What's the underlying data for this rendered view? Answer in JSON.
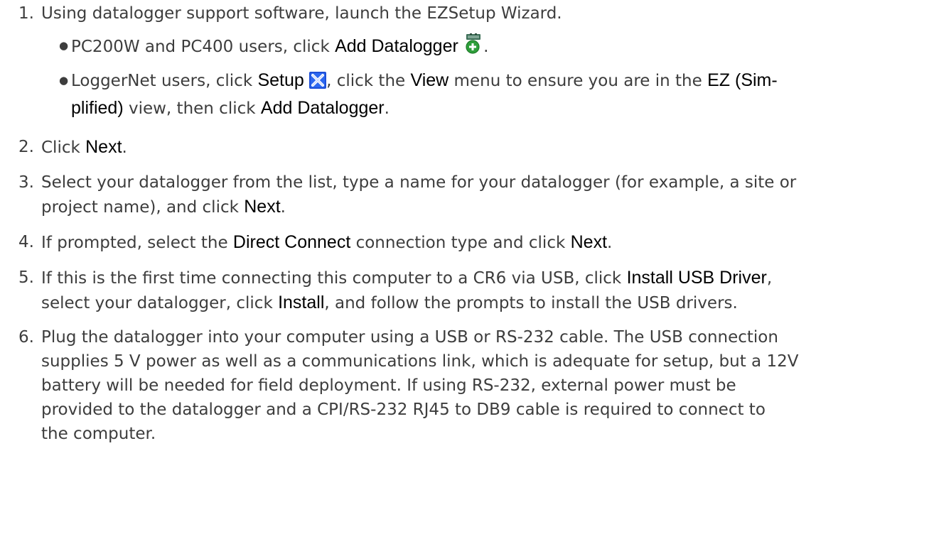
{
  "steps": [
    {
      "number": "1.",
      "text": "Using datalogger support software, launch the EZSetup Wizard.",
      "bullets": [
        {
          "t1": "PC200W and PC400 users, click ",
          "k1": "Add Datalogger",
          "icon": "add-datalogger-icon",
          "t2": "."
        },
        {
          "t1": "LoggerNet users, click ",
          "k1": "Setup",
          "icon": "setup-icon",
          "t2": ", click the ",
          "k2": "View",
          "t3": " menu to ensure you are in the ",
          "k3a": "EZ (Sim-",
          "k3b": "plified)",
          "t4": " view, then click ",
          "k4": "Add Datalogger",
          "t5": "."
        }
      ]
    },
    {
      "number": "2.",
      "t1": "Click ",
      "k1": "Next",
      "t2": "."
    },
    {
      "number": "3.",
      "line1": "Select your datalogger from the list, type a name for your datalogger (for example, a site or",
      "t1": "project name), and click ",
      "k1": "Next",
      "t2": "."
    },
    {
      "number": "4.",
      "t1": "If prompted, select the ",
      "k1": "Direct Connect",
      "t2": " connection type and click ",
      "k2": "Next",
      "t3": "."
    },
    {
      "number": "5.",
      "t1": "If this is the first time connecting this computer to a CR6 via USB, click ",
      "k1": "Install USB Driver",
      "t2": ",",
      "t3": "select your datalogger, click ",
      "k2": "Install",
      "t4": ", and follow the prompts to install the USB drivers."
    },
    {
      "number": "6.",
      "lines": [
        "Plug the datalogger into your computer using a USB or RS-232 cable. The USB connection",
        "supplies 5 V power as well as a communications link, which is adequate for setup, but a 12V",
        "battery will be needed for field deployment. If using RS-232, external power must be",
        "provided to the datalogger and a CPI/RS-232 RJ45 to DB9 cable is required to connect to",
        "the computer."
      ]
    }
  ],
  "colors": {
    "text": "#3d3d3d",
    "keyword": "#000000",
    "setup_icon": "#1d4fd8",
    "add_icon_plus": "#2e9e3a"
  }
}
